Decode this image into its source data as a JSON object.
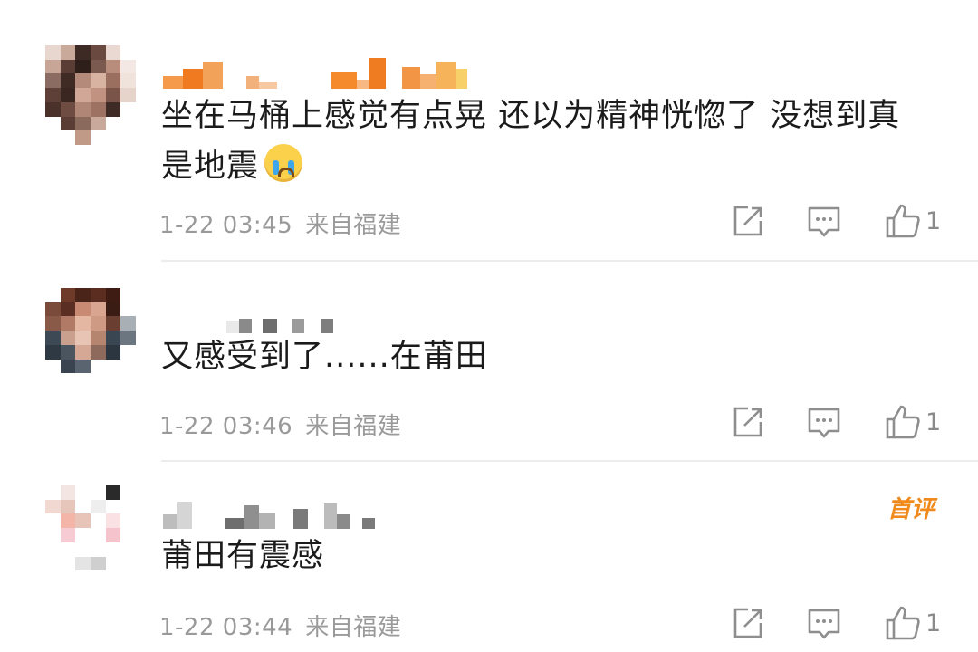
{
  "comments": [
    {
      "text_line1": "坐在马桶上感觉有点晃 还以为精神恍惚了 没想到真",
      "text_line2": "是地震",
      "emoji": "crying-face-icon",
      "time": "1-22 03:45",
      "source": "来自福建",
      "likes": "1"
    },
    {
      "text_line1": "又感受到了......在莆田",
      "time": "1-22 03:46",
      "source": "来自福建",
      "likes": "1"
    },
    {
      "badge": "首评",
      "text_line1": "莆田有震感",
      "time": "1-22 03:44",
      "source": "来自福建",
      "likes": "1"
    }
  ],
  "colors": {
    "text": "#1b1b1b",
    "meta": "#9a9a9a",
    "badge": "#f08a1c",
    "divider": "#ececec"
  }
}
